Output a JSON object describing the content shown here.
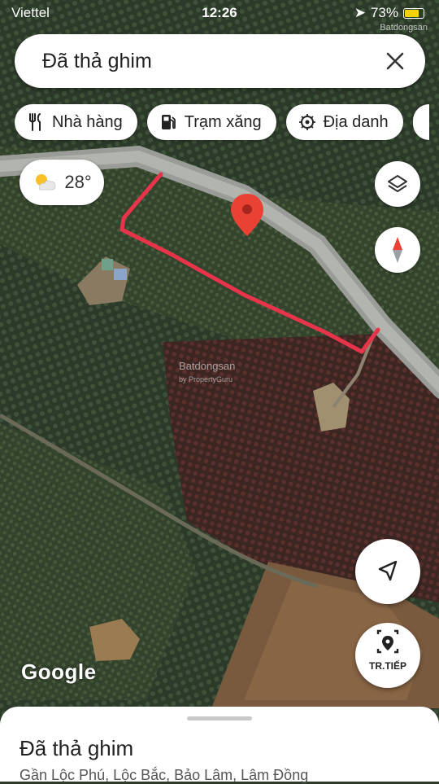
{
  "status_bar": {
    "carrier": "Viettel",
    "time": "12:26",
    "battery": "73%"
  },
  "watermark": {
    "brand": "Batdongsan",
    "sub": "by PropertyGuru"
  },
  "search": {
    "query": "Đã thả ghim"
  },
  "chips": [
    {
      "label": "Nhà hàng",
      "icon": "restaurant-icon"
    },
    {
      "label": "Trạm xăng",
      "icon": "gas-station-icon"
    },
    {
      "label": "Địa danh",
      "icon": "landmark-icon"
    }
  ],
  "weather": {
    "temperature": "28°",
    "icon": "partly-sunny-icon"
  },
  "map_buttons": {
    "layers_icon": "layers-icon",
    "compass_icon": "compass-icon",
    "locate_icon": "navigation-arrow-icon"
  },
  "fab": {
    "label": "TR.TIẾP",
    "icon": "directions-pin-icon"
  },
  "map": {
    "attribution": "Google",
    "pin_color": "#e94235",
    "route_color": "#e8344a",
    "road_color": "#9a9c97"
  },
  "place_sheet": {
    "title": "Đã thả ghim",
    "address": "Gần Lộc Phú, Lộc Bắc, Bảo Lâm, Lâm Đồng"
  }
}
